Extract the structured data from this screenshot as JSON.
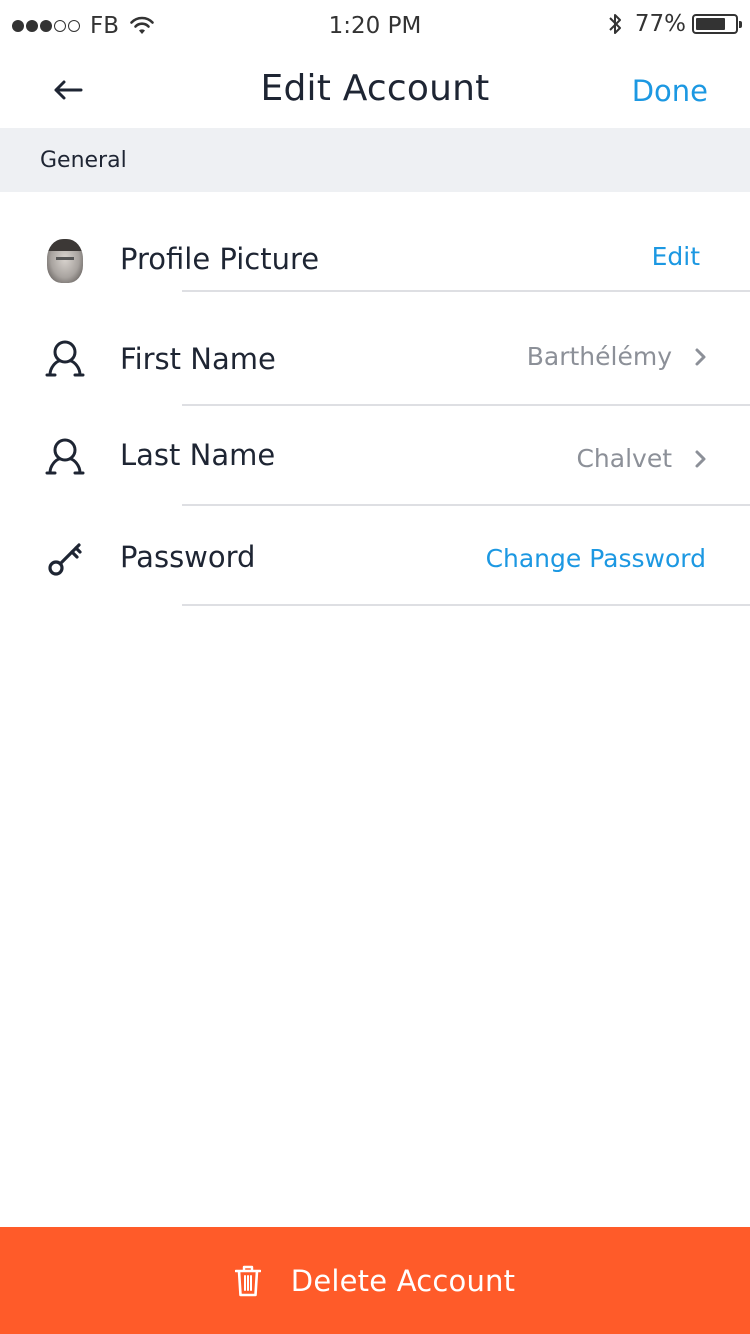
{
  "status_bar": {
    "carrier": "FB",
    "time": "1:20 PM",
    "battery_percent": "77%",
    "battery_level": 0.77,
    "signal_bars_filled": 3,
    "signal_bars_total": 5
  },
  "nav": {
    "title": "Edit Account",
    "back_icon": "arrow-left-icon",
    "done_label": "Done"
  },
  "section": {
    "title": "General"
  },
  "rows": [
    {
      "label": "Profile Picture",
      "icon": "avatar-image",
      "action_label": "Edit"
    },
    {
      "label": "First Name",
      "icon": "user-icon",
      "value": "Barthélémy",
      "trailing_icon": "chevron-right-icon"
    },
    {
      "label": "Last Name",
      "icon": "user-icon",
      "value": "Chalvet",
      "trailing_icon": "chevron-right-icon"
    },
    {
      "label": "Password",
      "icon": "key-icon",
      "action_label": "Change Password"
    }
  ],
  "delete": {
    "label": "Delete Account",
    "icon": "trash-icon"
  },
  "colors": {
    "accent": "#1c98e2",
    "danger": "#ff5b29",
    "text": "#1e2533",
    "muted": "#8c9098",
    "section_bg": "#eef0f3"
  }
}
